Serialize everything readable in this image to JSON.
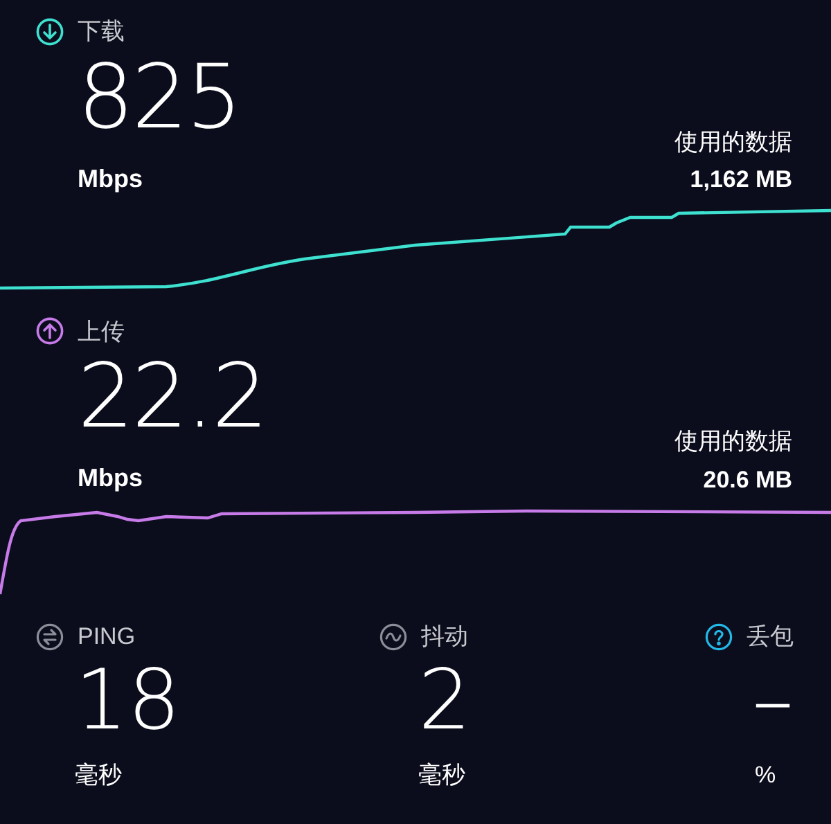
{
  "sections": [
    {
      "kind": "download",
      "label": "下载",
      "color": "#3ee0d0",
      "value": "825",
      "unit": "Mbps",
      "data_label": "使用的数据",
      "data_value": "1,162 MB"
    },
    {
      "kind": "upload",
      "label": "上传",
      "color": "#c77be8",
      "value": "22.2",
      "unit": "Mbps",
      "data_label": "使用的数据",
      "data_value": "20.6 MB"
    }
  ],
  "metrics": [
    {
      "kind": "ping",
      "label": "PING",
      "color": "#8b8e99",
      "value": "18",
      "unit": "毫秒"
    },
    {
      "kind": "jitter",
      "label": "抖动",
      "color": "#8b8e99",
      "value": "2",
      "unit": "毫秒"
    },
    {
      "kind": "loss",
      "label": "丢包",
      "color": "#22b8e8",
      "value": "–",
      "unit": "%"
    }
  ]
}
